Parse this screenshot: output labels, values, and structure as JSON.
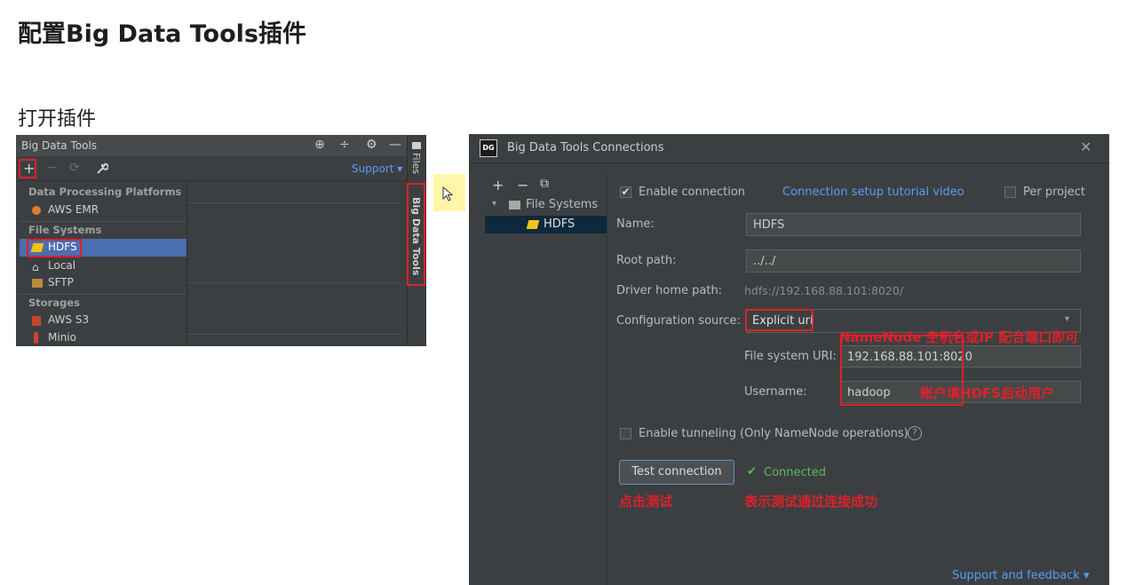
{
  "slide": {
    "title": "配置Big Data Tools插件",
    "section": "打开插件"
  },
  "left_panel": {
    "title": "Big Data Tools",
    "toolbar": {
      "add": "+",
      "remove": "−",
      "support": "Support ▾"
    },
    "side_tabs": {
      "files": "Files",
      "bdt": "Big Data Tools"
    },
    "dropdown": [
      {
        "type": "header",
        "label": "Data Processing Platforms"
      },
      {
        "type": "item",
        "label": "AWS EMR",
        "icon": "aws-emr-icon"
      },
      {
        "type": "header",
        "label": "File Systems"
      },
      {
        "type": "item",
        "label": "HDFS",
        "icon": "hdfs-icon",
        "selected": true
      },
      {
        "type": "item",
        "label": "Local",
        "icon": "home-icon"
      },
      {
        "type": "item",
        "label": "SFTP",
        "icon": "sftp-icon"
      },
      {
        "type": "header",
        "label": "Storages"
      },
      {
        "type": "item",
        "label": "AWS S3",
        "icon": "aws-s3-icon"
      },
      {
        "type": "item",
        "label": "Minio",
        "icon": "minio-icon"
      }
    ]
  },
  "dialog": {
    "logo": "DG",
    "title": "Big Data Tools Connections",
    "tree": {
      "toolbar": [
        "+",
        "−",
        "⧉"
      ],
      "group": "File Systems",
      "item": "HDFS"
    },
    "enable_connection": "Enable connection",
    "tutorial_link": "Connection setup tutorial video",
    "per_project": "Per project",
    "name_label": "Name:",
    "name_value": "HDFS",
    "root_path_label": "Root path:",
    "root_path_value": "../../",
    "driver_label": "Driver home path:",
    "driver_value": "hdfs://192.168.88.101:8020/",
    "config_label": "Configuration source:",
    "config_value": "Explicit uri",
    "uri_label": "File system URI:",
    "uri_value": "192.168.88.101:8020",
    "username_label": "Username:",
    "username_value": "hadoop",
    "tunneling": "Enable tunneling (Only NameNode operations)",
    "test_button": "Test connection",
    "connected": "Connected",
    "support_link": "Support and feedback ▾"
  },
  "annotations": {
    "namenode": "NameNode 主机名或IP 配合端口即可",
    "account": "账户填HDFS启动用户",
    "click_test": "点击测试",
    "success": "表示测试通过连接成功"
  },
  "colors": {
    "accent": "#589df6",
    "annotation": "#e0202a",
    "selection": "#4b6eaf",
    "success": "#5fb85f"
  }
}
